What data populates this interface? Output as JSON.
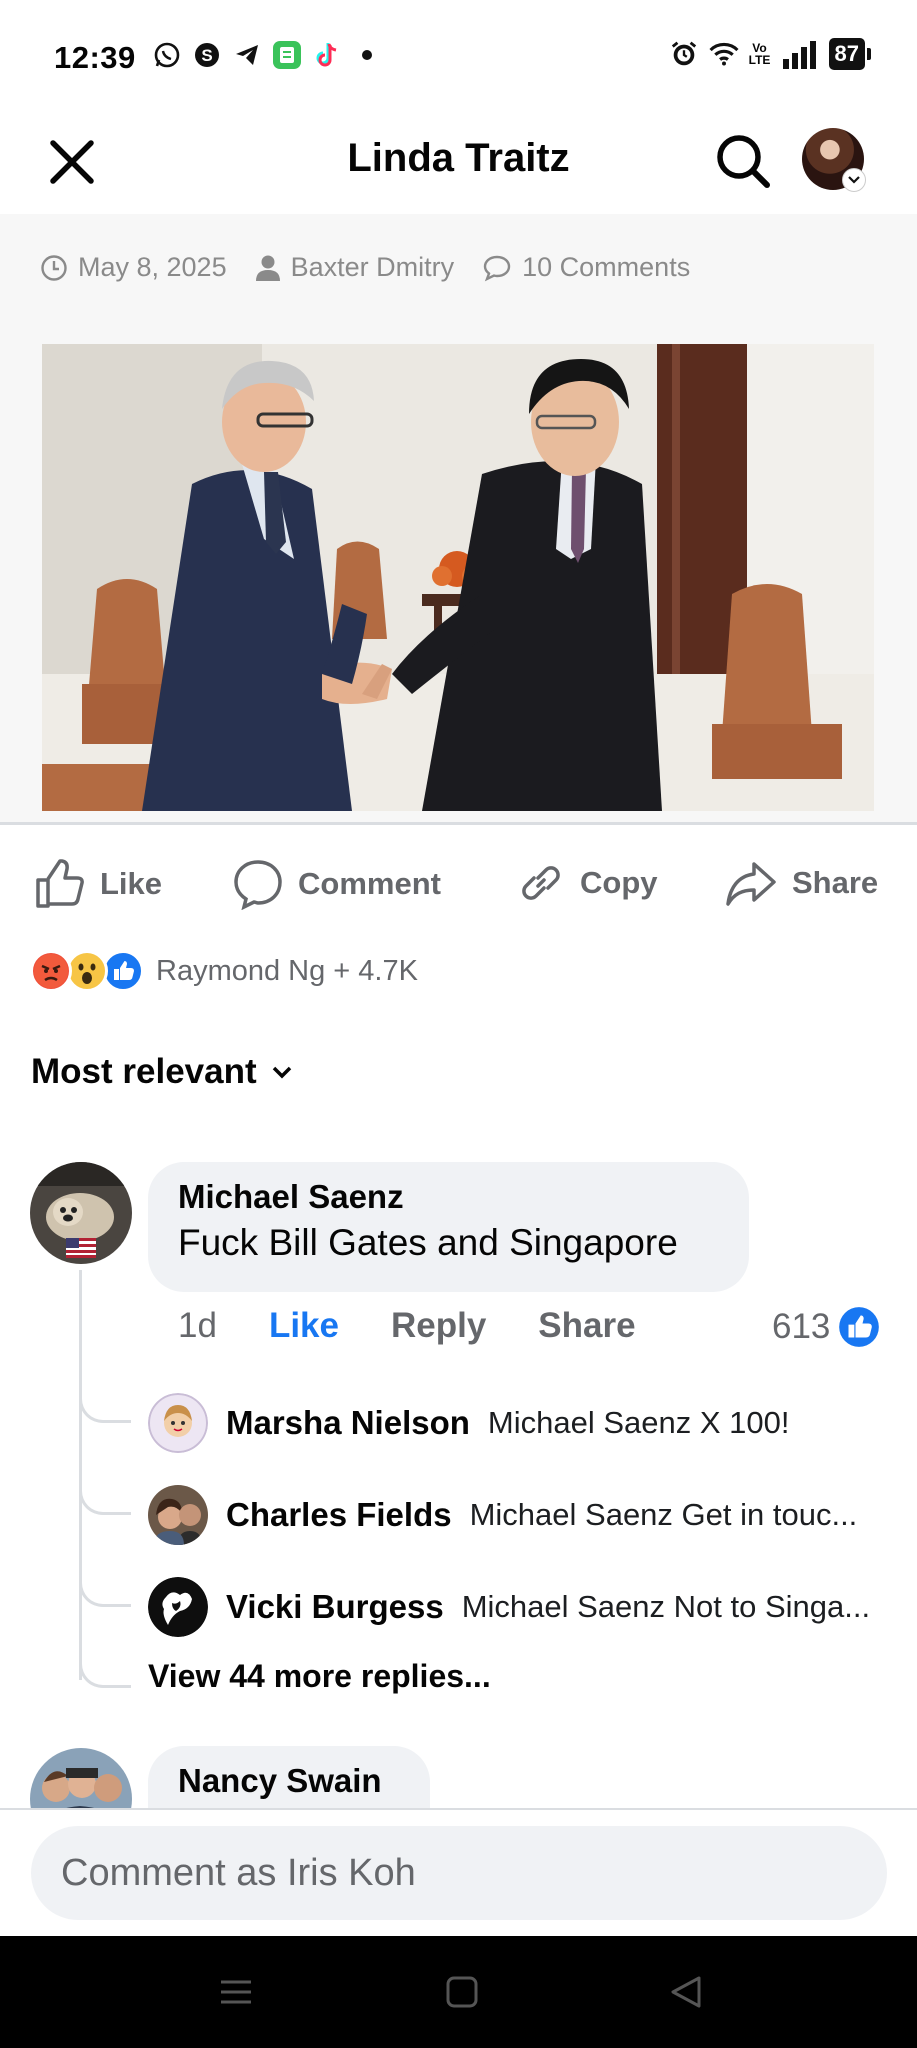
{
  "status_bar": {
    "time": "12:39",
    "battery": "87",
    "network": "Vo LTE"
  },
  "header": {
    "title": "Linda Traitz"
  },
  "article": {
    "date": "May 8, 2025",
    "author": "Baxter Dmitry",
    "comments": "10 Comments"
  },
  "actions": {
    "like": "Like",
    "comment": "Comment",
    "copy": "Copy",
    "share": "Share"
  },
  "reactions": {
    "summary": "Raymond Ng + 4.7K"
  },
  "sort": {
    "label": "Most relevant"
  },
  "comments": [
    {
      "name": "Michael Saenz",
      "text": "Fuck Bill Gates and Singapore",
      "time": "1d",
      "like": "Like",
      "reply": "Reply",
      "share": "Share",
      "likes": "613",
      "replies": [
        {
          "name": "Marsha Nielson",
          "text": "Michael Saenz X 100!"
        },
        {
          "name": "Charles Fields",
          "text": "Michael Saenz Get in touc..."
        },
        {
          "name": "Vicki Burgess",
          "text": "Michael Saenz Not to Singa..."
        }
      ],
      "more_replies": "View 44 more replies..."
    },
    {
      "name": "Nancy Swain"
    }
  ],
  "composer": {
    "placeholder": "Comment as Iris Koh"
  },
  "colors": {
    "accent": "#1877f2",
    "muted": "#65676b",
    "bubble": "#f0f2f5"
  }
}
